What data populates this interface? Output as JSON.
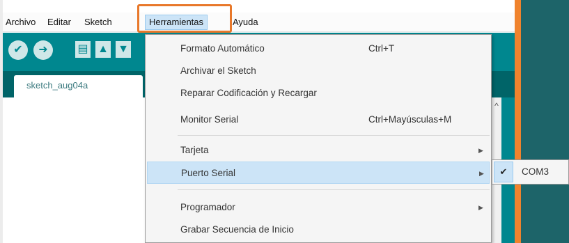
{
  "menubar": {
    "items": [
      "Archivo",
      "Editar",
      "Sketch",
      "Herramientas",
      "Ayuda"
    ]
  },
  "toolbar": {
    "buttons": [
      {
        "icon": "verify-icon",
        "glyph": "✔"
      },
      {
        "icon": "upload-icon",
        "glyph": "➜"
      },
      {
        "icon": "new-icon",
        "glyph": "▤"
      },
      {
        "icon": "open-icon",
        "glyph": "▲"
      },
      {
        "icon": "save-icon",
        "glyph": "▼"
      }
    ]
  },
  "tabs": {
    "active": "sketch_aug04a"
  },
  "menu_herramientas": {
    "items": [
      {
        "label": "Formato Automático",
        "shortcut": "Ctrl+T"
      },
      {
        "label": "Archivar el Sketch",
        "shortcut": ""
      },
      {
        "label": "Reparar Codificación y Recargar",
        "shortcut": ""
      },
      {
        "label": "Monitor Serial",
        "shortcut": "Ctrl+Mayúsculas+M"
      },
      {
        "label": "Tarjeta",
        "submenu": true
      },
      {
        "label": "Puerto Serial",
        "submenu": true,
        "highlighted": true
      },
      {
        "label": "Programador",
        "submenu": true
      },
      {
        "label": "Grabar Secuencia de Inicio",
        "shortcut": ""
      }
    ]
  },
  "submenu_puerto": {
    "items": [
      {
        "label": "COM3",
        "checked": true
      }
    ]
  },
  "colors": {
    "teal": "#00878f",
    "dark_teal": "#006468",
    "highlight_orange": "#e8782a",
    "menu_selected": "#cce4f7"
  }
}
